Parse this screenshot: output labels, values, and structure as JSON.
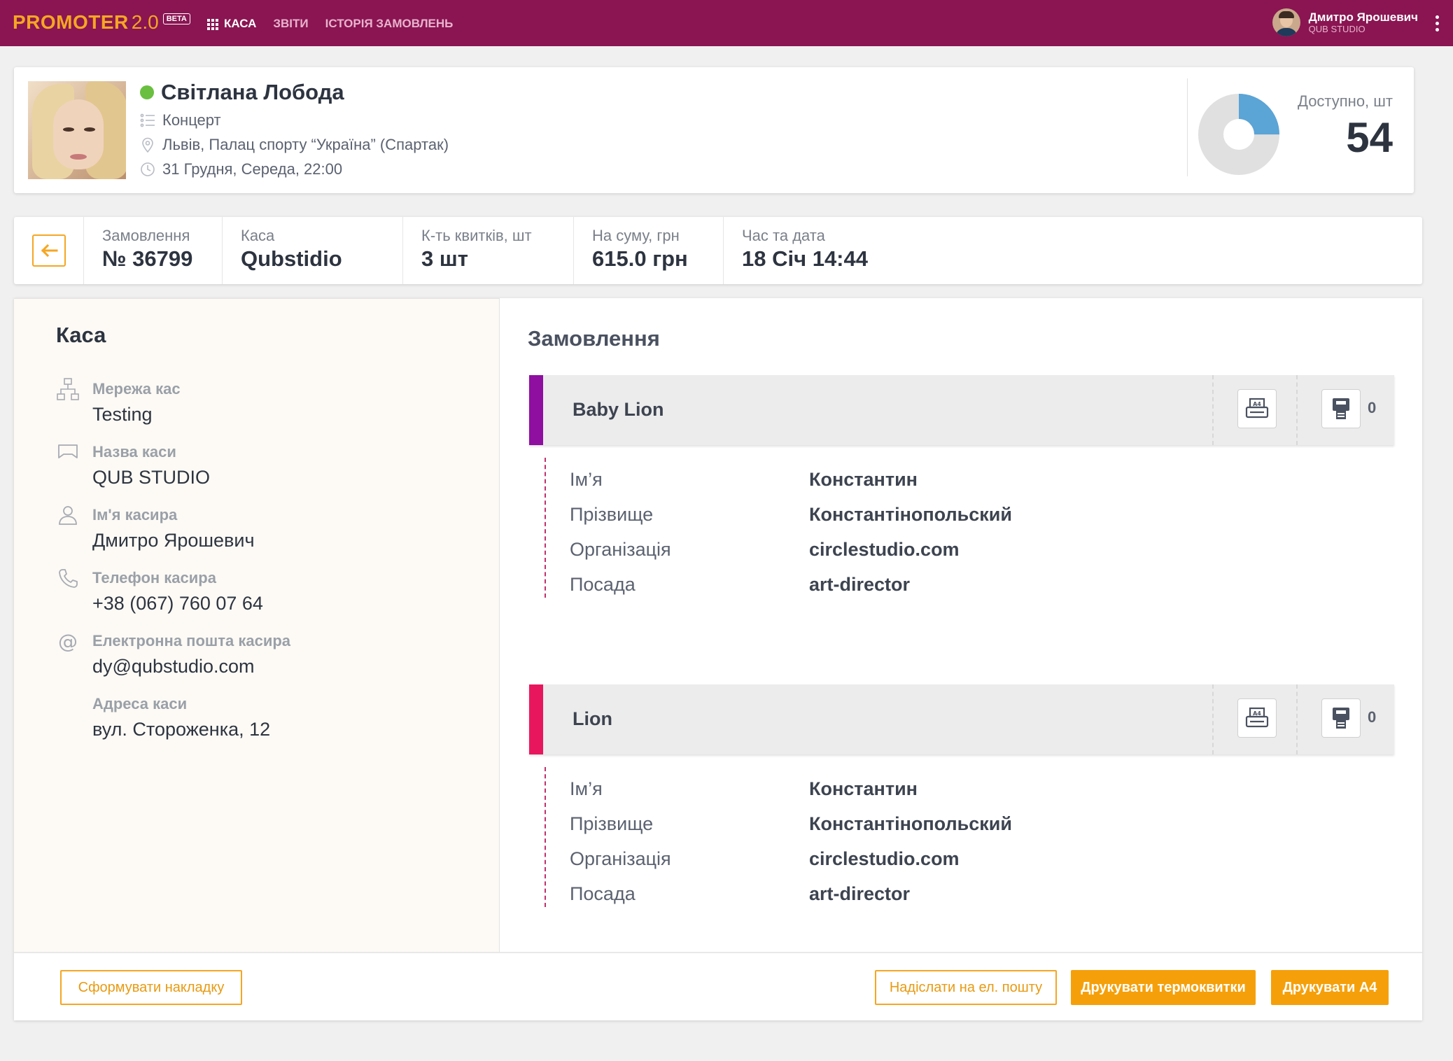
{
  "topbar": {
    "logo": "PROMOTER",
    "version": "2.0",
    "badge": "BETA",
    "nav": [
      {
        "label": "КАСА",
        "active": true
      },
      {
        "label": "ЗВІТИ",
        "active": false
      },
      {
        "label": "ІСТОРІЯ ЗАМОВЛЕНЬ",
        "active": false
      }
    ],
    "user": {
      "name": "Дмитро Ярошевич",
      "org": "QUB STUDIO"
    }
  },
  "event": {
    "title": "Світлана Лобода",
    "status_color": "#6abf40",
    "type": "Концерт",
    "venue": "Львів, Палац спорту “Україна” (Спартак)",
    "datetime": "31 Грудня, Середа, 22:00",
    "available_label": "Доступно, шт",
    "available_count": "54",
    "donut": {
      "filled_fraction": 0.25,
      "filled_color": "#5ba4d6",
      "rest_color": "#e0e0e0"
    }
  },
  "summary": {
    "order_label": "Замовлення",
    "order_value": "№ 36799",
    "box_label": "Каса",
    "box_value": "Qubstidio",
    "tickets_label": "К-ть квитків, шт",
    "tickets_value": "3 шт",
    "sum_label": "На суму, грн",
    "sum_value": "615.0 грн",
    "time_label": "Час та дата",
    "time_value": "18 Січ 14:44"
  },
  "cashbox": {
    "title": "Каса",
    "network_label": "Мережа кас",
    "network_value": "Testing",
    "name_label": "Назва каси",
    "name_value": "QUB STUDIO",
    "cashier_label": "Ім'я касира",
    "cashier_value": "Дмитро Ярошевич",
    "phone_label": "Телефон касира",
    "phone_value": "+38 (067) 760 07 64",
    "email_label": "Електронна пошта касира",
    "email_value": "dy@qubstudio.com",
    "address_label": "Адреса каси",
    "address_value": "вул. Стороженка, 12"
  },
  "order": {
    "title": "Замовлення",
    "tickets": [
      {
        "name": "Baby Lion",
        "color": "#8e0fa0",
        "count": "0",
        "fields": [
          {
            "label": "Ім’я",
            "value": "Константин"
          },
          {
            "label": "Прізвище",
            "value": "Константінопольский"
          },
          {
            "label": "Організація",
            "value": "circlestudio.com"
          },
          {
            "label": "Посада",
            "value": "art-director"
          }
        ]
      },
      {
        "name": "Lion",
        "color": "#e8175d",
        "count": "0",
        "fields": [
          {
            "label": "Ім’я",
            "value": "Константин"
          },
          {
            "label": "Прізвище",
            "value": "Константінопольский"
          },
          {
            "label": "Організація",
            "value": "circlestudio.com"
          },
          {
            "label": "Посада",
            "value": "art-director"
          }
        ]
      }
    ]
  },
  "footer": {
    "invoice": "Сформувати накладку",
    "email": "Надіслати на ел. пошту",
    "thermo": "Друкувати термоквитки",
    "a4": "Друкувати А4"
  }
}
